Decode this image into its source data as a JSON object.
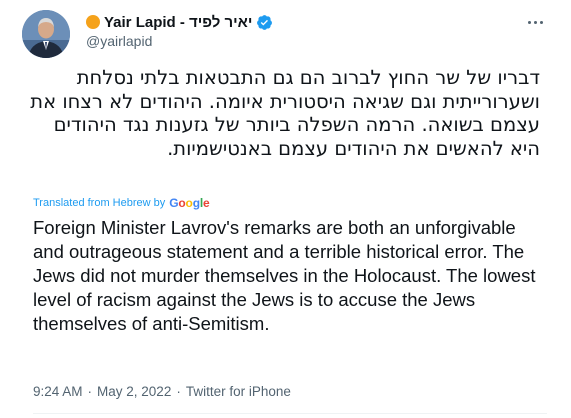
{
  "author": {
    "display_name": "Yair Lapid - יאיר לפיד",
    "handle": "@yairlapid",
    "avatar_icon": "profile-photo",
    "badge_dot_color": "#f5a21b",
    "verified_icon": "verified-badge-icon",
    "verified_color": "#1d9bf0"
  },
  "tweet": {
    "text_hebrew": "דבריו של שר החוץ לברוב הם גם התבטאות בלתי נסלחת ושערורייתית וגם שגיאה היסטורית איומה. היהודים לא רצחו את עצמם בשואה. הרמה השפלה ביותר של גזענות נגד היהודים היא להאשים את היהודים עצמם באנטישמיות.",
    "translated_label": "Translated from Hebrew by",
    "translator_logo": "Google",
    "text_english": "Foreign Minister Lavrov's remarks are both an unforgivable and outrageous statement and a terrible historical error. The Jews did not murder themselves in the Holocaust. The lowest level of racism against the Jews is to accuse the Jews themselves of anti-Semitism."
  },
  "meta": {
    "time": "9:24 AM",
    "separator1": "·",
    "date": "May 2, 2022",
    "separator2": "·",
    "source": "Twitter for iPhone"
  },
  "colors": {
    "text": "#0f1419",
    "secondary": "#536471",
    "accent": "#1d9bf0"
  }
}
